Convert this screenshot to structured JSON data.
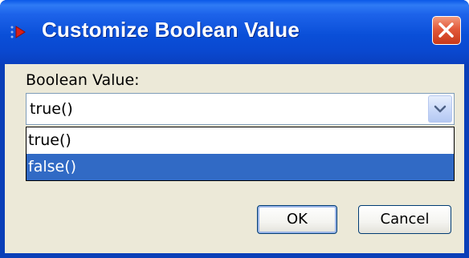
{
  "window": {
    "title": "Customize Boolean Value"
  },
  "form": {
    "label": "Boolean Value:",
    "selected_value": "true()",
    "options": [
      "true()",
      "false()"
    ],
    "highlighted_option": "false()"
  },
  "buttons": {
    "ok": "OK",
    "cancel": "Cancel"
  },
  "icons": {
    "title_icon": "red-arrow-icon",
    "close": "close-icon",
    "dropdown": "chevron-down-icon"
  },
  "colors": {
    "titlebar": "#0a4fd8",
    "selection": "#316ac5",
    "close_button": "#e2593a",
    "dialog_background": "#ece9d8"
  }
}
